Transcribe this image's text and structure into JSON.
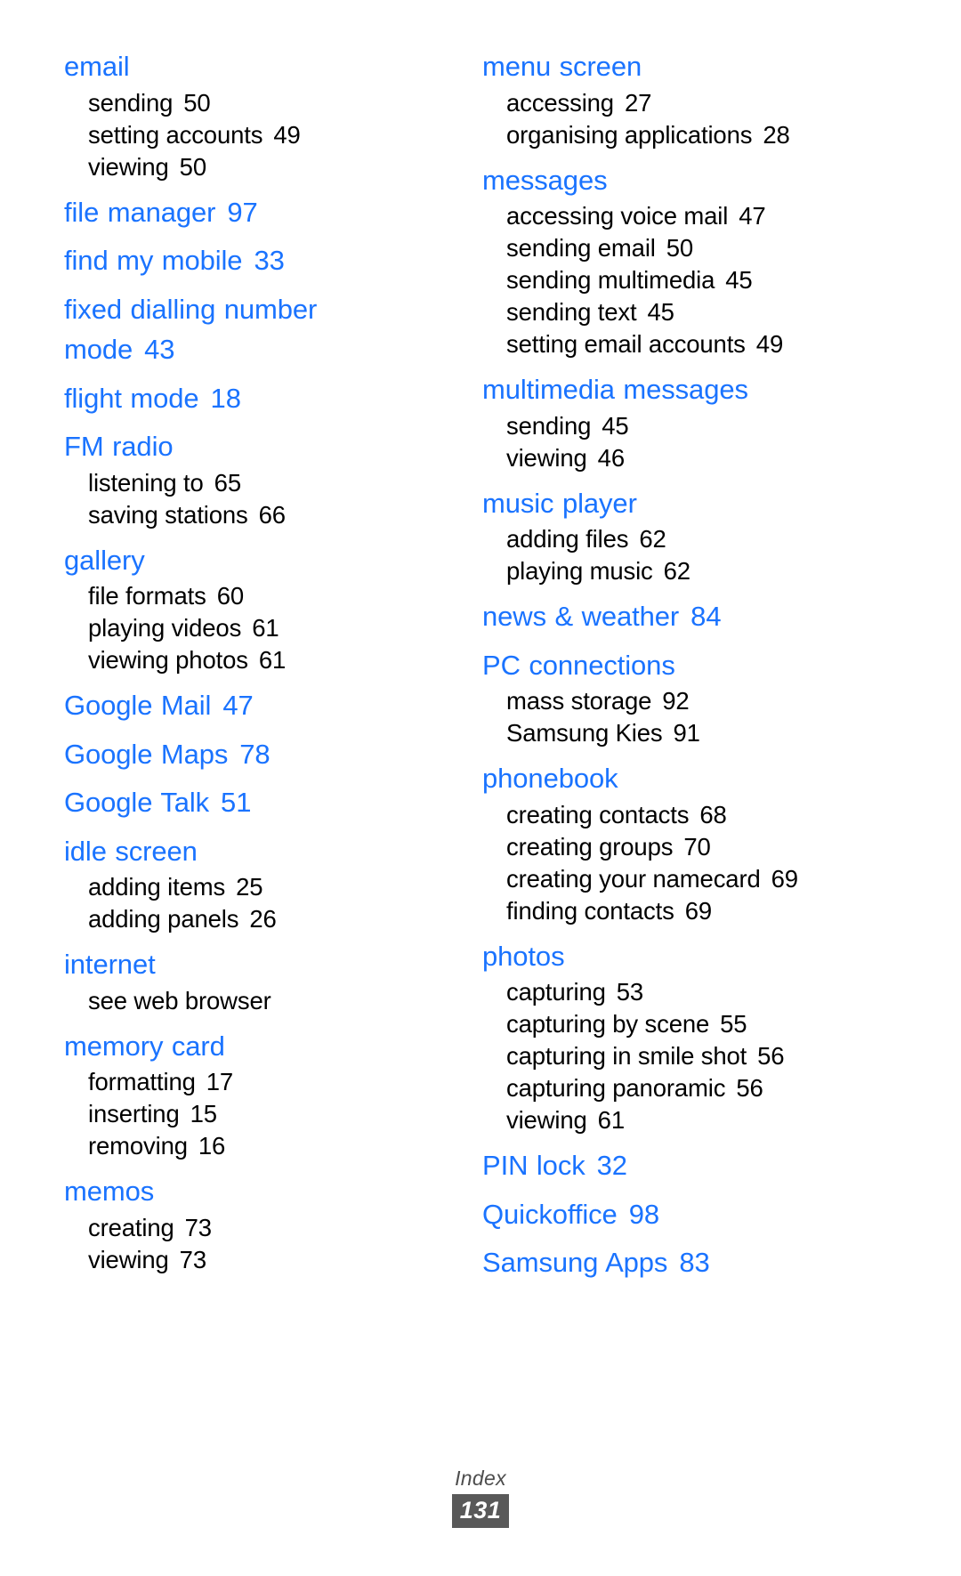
{
  "document": {
    "footer_label": "Index",
    "page_number": "131",
    "heading_color": "#1a73ff",
    "body_color": "#000000",
    "badge_bg_color": "#595959"
  },
  "columns": [
    {
      "name": "left-column",
      "entries": [
        {
          "term": "email",
          "page": "",
          "subs": [
            {
              "term": "sending",
              "page": "50"
            },
            {
              "term": "setting accounts",
              "page": "49"
            },
            {
              "term": "viewing",
              "page": "50"
            }
          ]
        },
        {
          "term": "file manager",
          "page": "97",
          "subs": []
        },
        {
          "term": "find my mobile",
          "page": "33",
          "subs": []
        },
        {
          "term": "fixed dialling number mode",
          "page": "43",
          "subs": []
        },
        {
          "term": "flight mode",
          "page": "18",
          "subs": []
        },
        {
          "term": "FM radio",
          "page": "",
          "subs": [
            {
              "term": "listening to",
              "page": "65"
            },
            {
              "term": "saving stations",
              "page": "66"
            }
          ]
        },
        {
          "term": "gallery",
          "page": "",
          "subs": [
            {
              "term": "file formats",
              "page": "60"
            },
            {
              "term": "playing videos",
              "page": "61"
            },
            {
              "term": "viewing photos",
              "page": "61"
            }
          ]
        },
        {
          "term": "Google Mail",
          "page": "47",
          "subs": []
        },
        {
          "term": "Google Maps",
          "page": "78",
          "subs": []
        },
        {
          "term": "Google Talk",
          "page": "51",
          "subs": []
        },
        {
          "term": "idle screen",
          "page": "",
          "subs": [
            {
              "term": "adding items",
              "page": "25"
            },
            {
              "term": "adding panels",
              "page": "26"
            }
          ]
        },
        {
          "term": "internet",
          "page": "",
          "subs": [
            {
              "term": "see web browser",
              "page": ""
            }
          ]
        },
        {
          "term": "memory card",
          "page": "",
          "subs": [
            {
              "term": "formatting",
              "page": "17"
            },
            {
              "term": "inserting",
              "page": "15"
            },
            {
              "term": "removing",
              "page": "16"
            }
          ]
        },
        {
          "term": "memos",
          "page": "",
          "subs": [
            {
              "term": "creating",
              "page": "73"
            },
            {
              "term": "viewing",
              "page": "73"
            }
          ]
        }
      ]
    },
    {
      "name": "right-column",
      "entries": [
        {
          "term": "menu screen",
          "page": "",
          "subs": [
            {
              "term": "accessing",
              "page": "27"
            },
            {
              "term": "organising applications",
              "page": "28"
            }
          ]
        },
        {
          "term": "messages",
          "page": "",
          "subs": [
            {
              "term": "accessing voice mail",
              "page": "47"
            },
            {
              "term": "sending email",
              "page": "50"
            },
            {
              "term": "sending multimedia",
              "page": "45"
            },
            {
              "term": "sending text",
              "page": "45"
            },
            {
              "term": "setting email accounts",
              "page": "49"
            }
          ]
        },
        {
          "term": "multimedia messages",
          "page": "",
          "subs": [
            {
              "term": "sending",
              "page": "45"
            },
            {
              "term": "viewing",
              "page": "46"
            }
          ]
        },
        {
          "term": "music player",
          "page": "",
          "subs": [
            {
              "term": "adding files",
              "page": "62"
            },
            {
              "term": "playing music",
              "page": "62"
            }
          ]
        },
        {
          "term": "news & weather",
          "page": "84",
          "subs": []
        },
        {
          "term": "PC connections",
          "page": "",
          "subs": [
            {
              "term": "mass storage",
              "page": "92"
            },
            {
              "term": "Samsung Kies",
              "page": "91"
            }
          ]
        },
        {
          "term": "phonebook",
          "page": "",
          "subs": [
            {
              "term": "creating contacts",
              "page": "68"
            },
            {
              "term": "creating groups",
              "page": "70"
            },
            {
              "term": "creating your namecard",
              "page": "69"
            },
            {
              "term": "finding contacts",
              "page": "69"
            }
          ]
        },
        {
          "term": "photos",
          "page": "",
          "subs": [
            {
              "term": "capturing",
              "page": "53"
            },
            {
              "term": "capturing by scene",
              "page": "55"
            },
            {
              "term": "capturing in smile shot",
              "page": "56"
            },
            {
              "term": "capturing panoramic",
              "page": "56"
            },
            {
              "term": "viewing",
              "page": "61"
            }
          ]
        },
        {
          "term": "PIN lock",
          "page": "32",
          "subs": []
        },
        {
          "term": "Quickoffice",
          "page": "98",
          "subs": []
        },
        {
          "term": "Samsung Apps",
          "page": "83",
          "subs": []
        }
      ]
    }
  ]
}
